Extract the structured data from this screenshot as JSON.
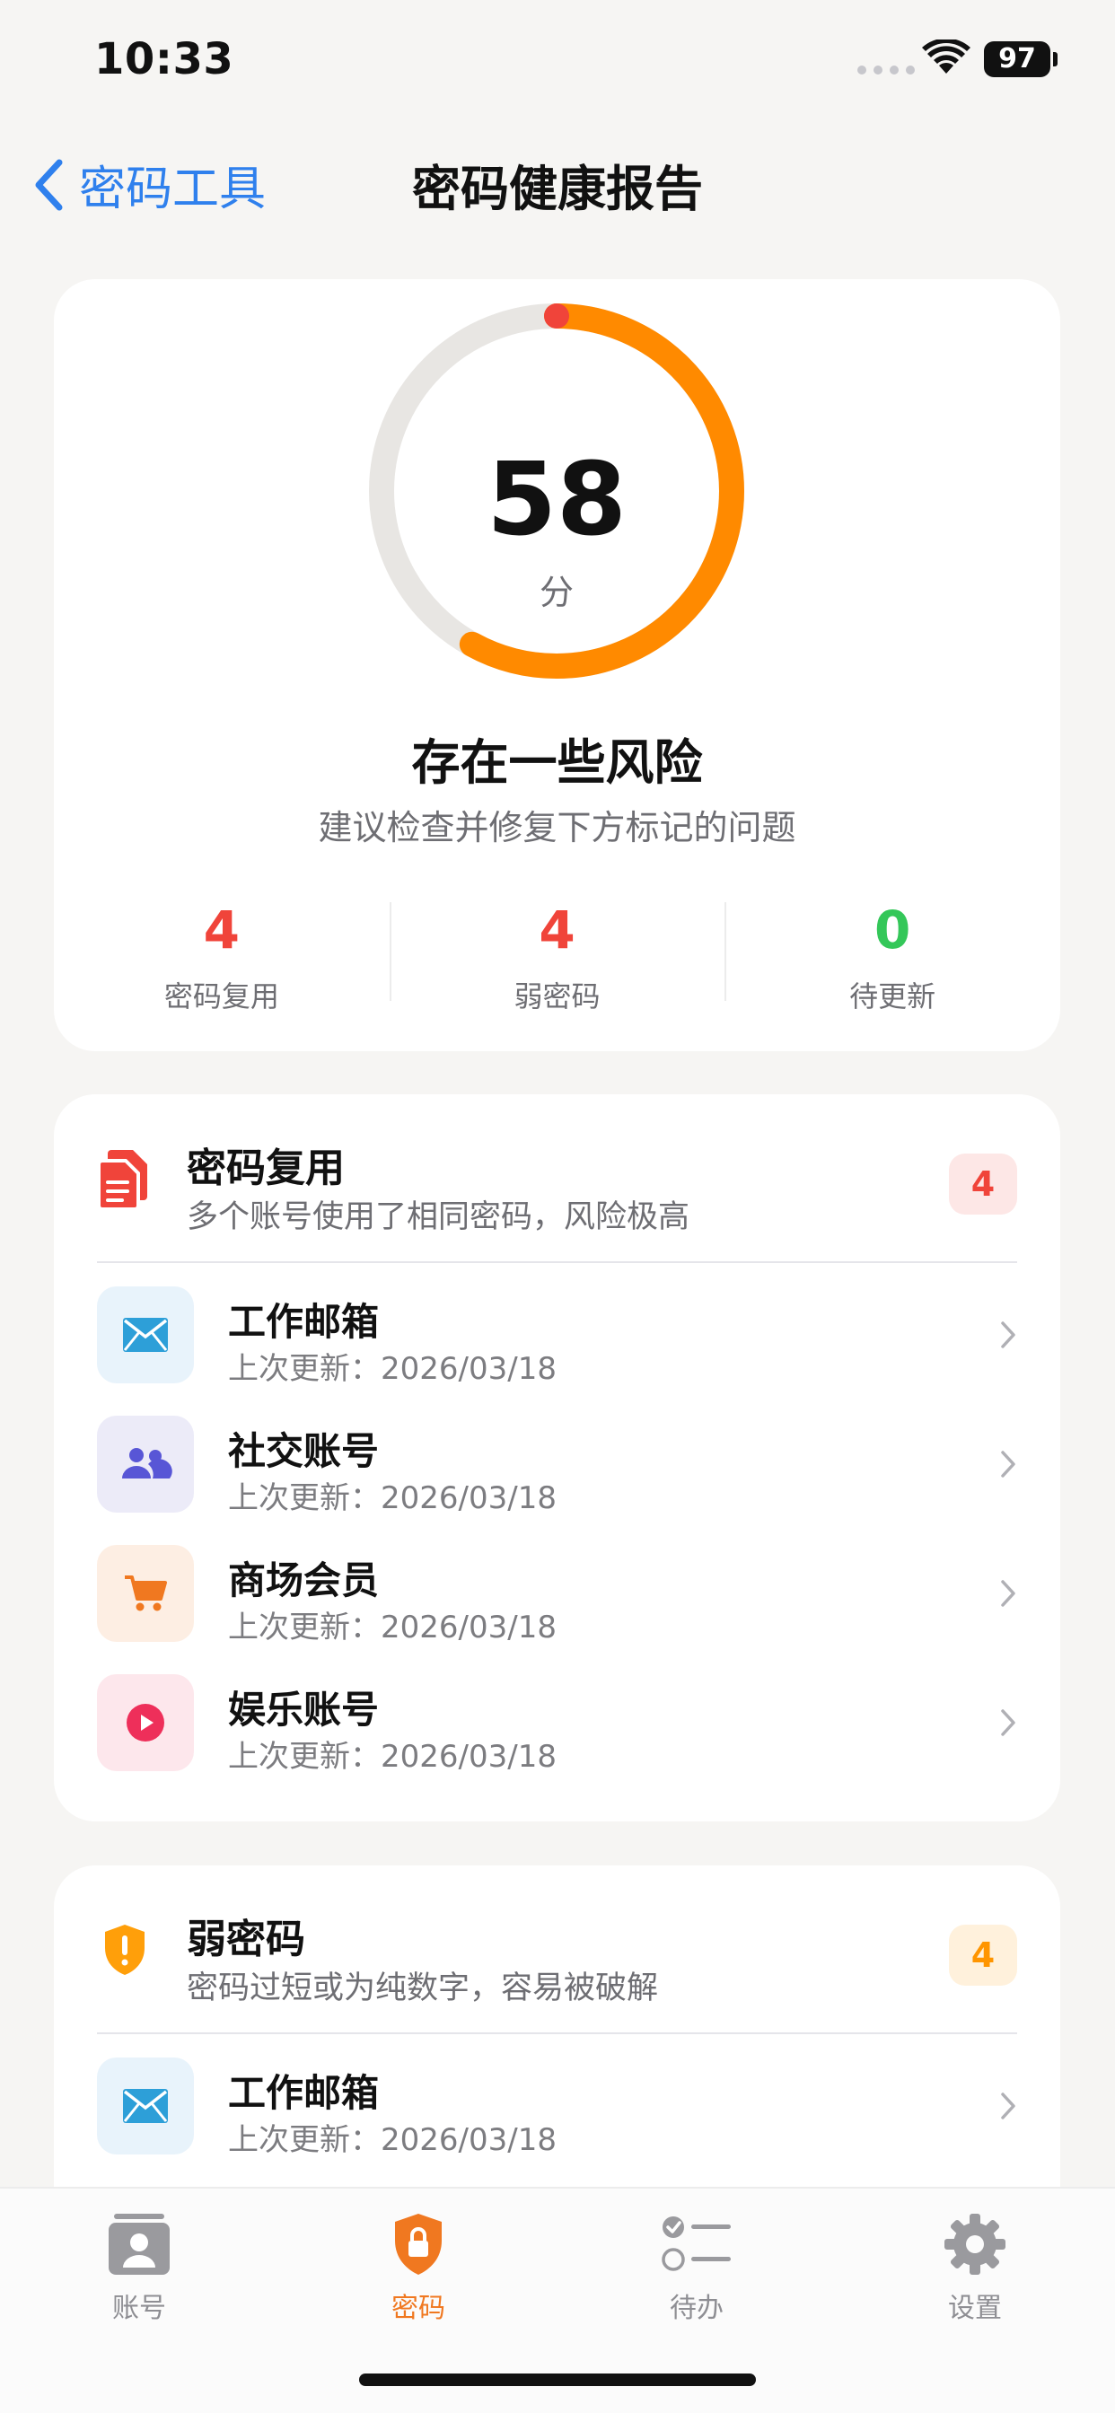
{
  "status_bar": {
    "time": "10:33",
    "battery": "97"
  },
  "nav": {
    "back_label": "密码工具",
    "title": "密码健康报告"
  },
  "score": {
    "value": "58",
    "unit": "分",
    "fraction": 0.58,
    "risk_title": "存在一些风险",
    "risk_desc": "建议检查并修复下方标记的问题",
    "ring_color": "#ff8a00",
    "track_color": "#e8e6e3",
    "stats": [
      {
        "value": "4",
        "label": "密码复用",
        "color": "#f0443a"
      },
      {
        "value": "4",
        "label": "弱密码",
        "color": "#f0443a"
      },
      {
        "value": "0",
        "label": "待更新",
        "color": "#34c759"
      }
    ]
  },
  "reuse": {
    "title": "密码复用",
    "desc": "多个账号使用了相同密码，风险极高",
    "badge": "4",
    "icon": "duplicate-doc-icon",
    "items": [
      {
        "title": "工作邮箱",
        "sub": "上次更新：2026/03/18",
        "icon": "mail-icon"
      },
      {
        "title": "社交账号",
        "sub": "上次更新：2026/03/18",
        "icon": "people-icon"
      },
      {
        "title": "商场会员",
        "sub": "上次更新：2026/03/18",
        "icon": "cart-icon"
      },
      {
        "title": "娱乐账号",
        "sub": "上次更新：2026/03/18",
        "icon": "play-icon"
      }
    ]
  },
  "weak": {
    "title": "弱密码",
    "desc": "密码过短或为纯数字，容易被破解",
    "badge": "4",
    "icon": "shield-alert-icon",
    "items": [
      {
        "title": "工作邮箱",
        "sub": "上次更新：2026/03/18",
        "icon": "mail-icon"
      }
    ]
  },
  "tabbar": {
    "tabs": [
      {
        "label": "账号",
        "icon": "contact-card-icon"
      },
      {
        "label": "密码",
        "icon": "lock-shield-icon",
        "active": true
      },
      {
        "label": "待办",
        "icon": "checklist-icon"
      },
      {
        "label": "设置",
        "icon": "gear-icon"
      }
    ],
    "active_color": "#f07820"
  }
}
